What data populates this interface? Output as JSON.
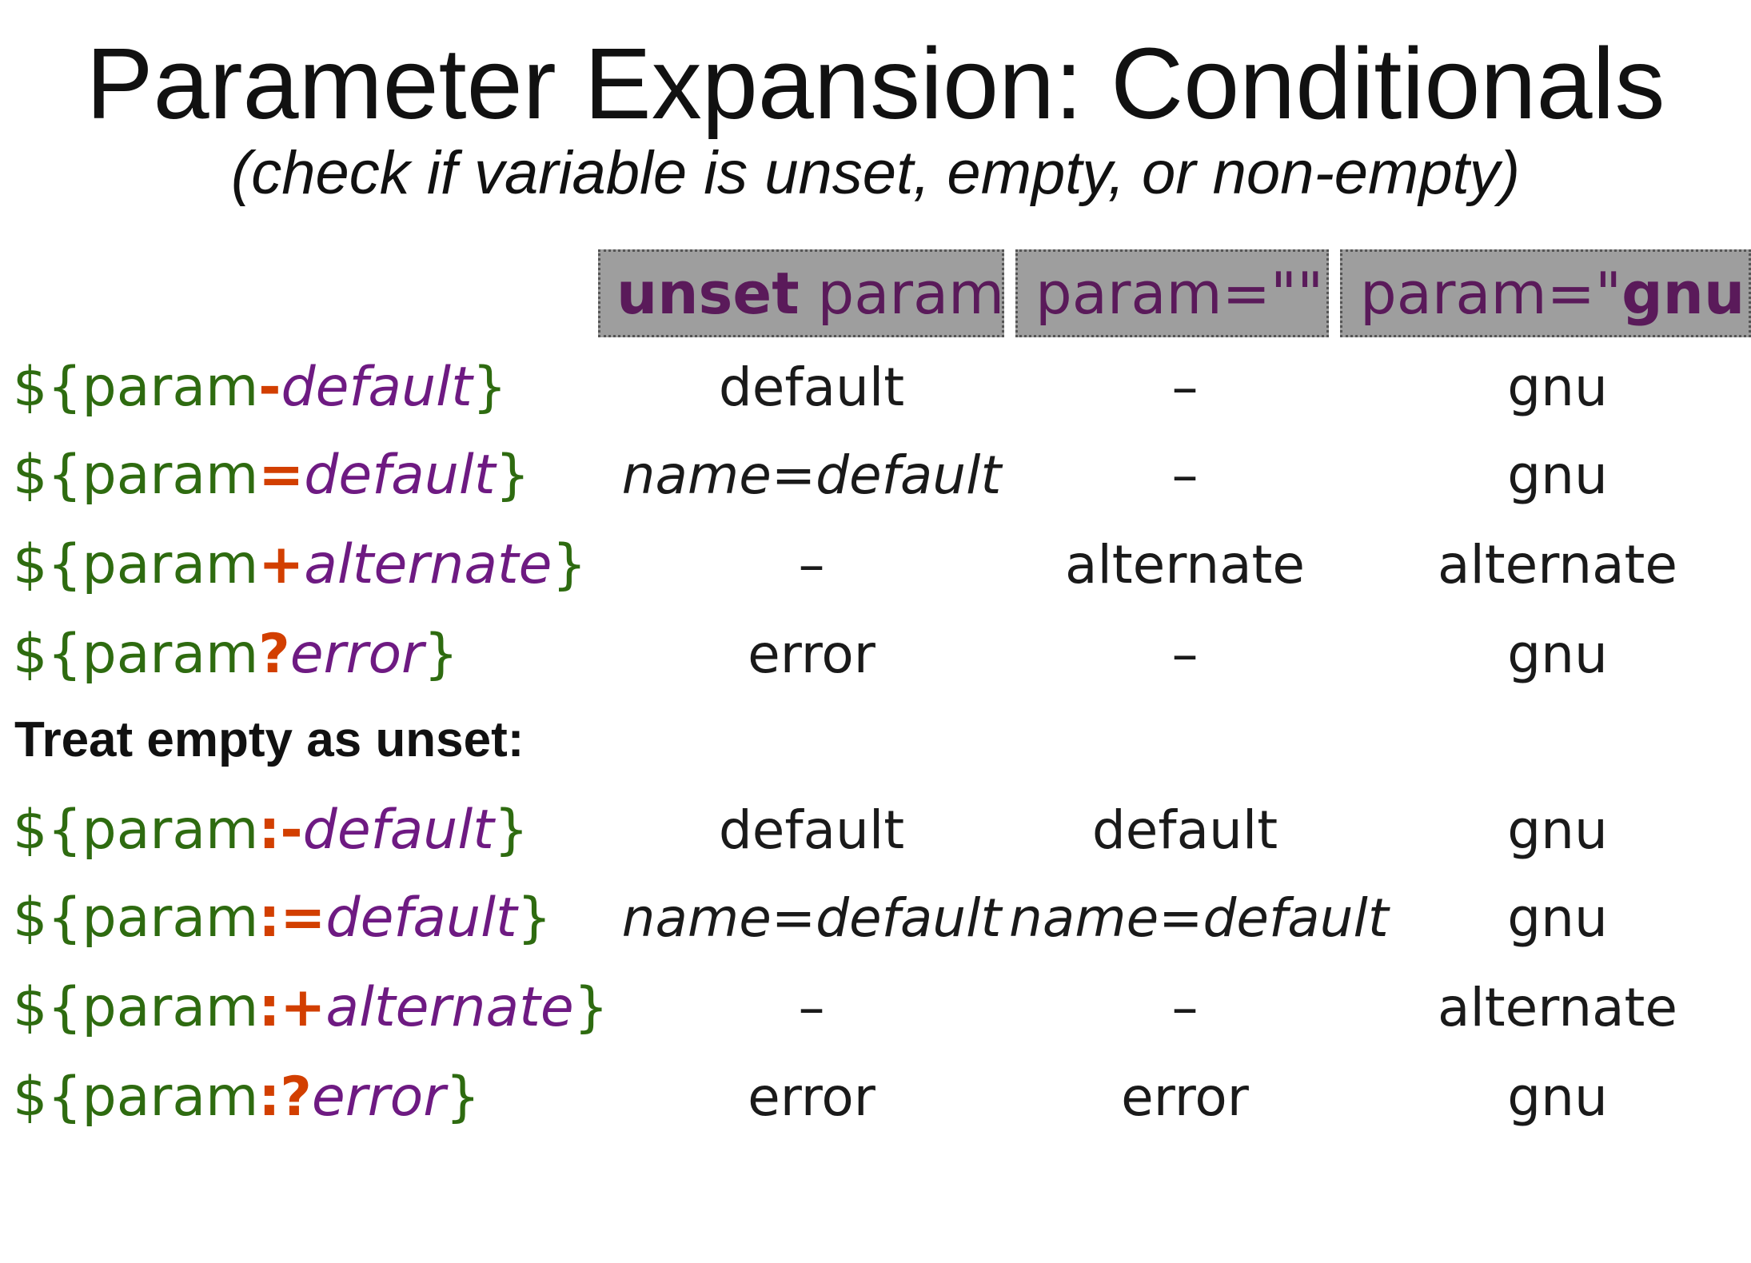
{
  "title": "Parameter Expansion: Conditionals",
  "subtitle": "(check if variable is unset, empty, or non-empty)",
  "columns": [
    {
      "bold": "unset",
      "rest": " param"
    },
    {
      "pre": "param=\"\"",
      "bold": "",
      "post": ""
    },
    {
      "pre": "param=\"",
      "bold": "gnu",
      "post": "\""
    }
  ],
  "section_label": "Treat empty as unset:",
  "rows": [
    {
      "prefix": "${param",
      "op": "-",
      "arg": "default",
      "suffix": "}",
      "cells": [
        "default",
        "–",
        "gnu"
      ]
    },
    {
      "prefix": "${param",
      "op": "=",
      "arg": "default",
      "suffix": "}",
      "cells": [
        "name=default",
        "–",
        "gnu"
      ]
    },
    {
      "prefix": "${param",
      "op": "+",
      "arg": "alternate",
      "suffix": "}",
      "cells": [
        "–",
        "alternate",
        "alternate"
      ]
    },
    {
      "prefix": "${param",
      "op": "?",
      "arg": "error",
      "suffix": "}",
      "cells": [
        "error",
        "–",
        "gnu"
      ]
    },
    {
      "prefix": "${param",
      "op": ":-",
      "arg": "default",
      "suffix": "}",
      "cells": [
        "default",
        "default",
        "gnu"
      ]
    },
    {
      "prefix": "${param",
      "op": ":=",
      "arg": "default",
      "suffix": "}",
      "cells": [
        "name=default",
        "name=default",
        "gnu"
      ]
    },
    {
      "prefix": "${param",
      "op": ":+",
      "arg": "alternate",
      "suffix": "}",
      "cells": [
        "–",
        "–",
        "alternate"
      ]
    },
    {
      "prefix": "${param",
      "op": ":?",
      "arg": "error",
      "suffix": "}",
      "cells": [
        "error",
        "error",
        "gnu"
      ]
    }
  ],
  "colors": {
    "syntax": "#2e6b10",
    "operator": "#d23f00",
    "argument": "#6e1a82",
    "header_bg": "#9e9e9e",
    "header_text": "#5a1a5a"
  }
}
